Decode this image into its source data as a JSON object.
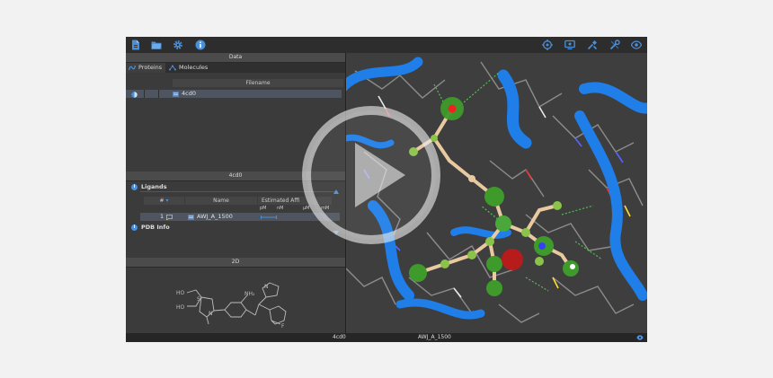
{
  "panels": {
    "data_title": "Data",
    "ligands_panel_title": "4cd0",
    "twod_title": "2D"
  },
  "tabs": [
    {
      "label": "Proteins"
    },
    {
      "label": "Molecules"
    }
  ],
  "proteins_table": {
    "column": "Filename",
    "rows": [
      {
        "filename": "4cd0"
      }
    ]
  },
  "ligands": {
    "section_label": "Ligands",
    "columns": {
      "num": "#",
      "name": "Name",
      "affinity": "Estimated Affi"
    },
    "affinity_units": [
      "pM",
      "nM",
      "µM",
      "mM"
    ],
    "rows": [
      {
        "num": "1",
        "name": "AWJ_A_1500"
      }
    ]
  },
  "pdb_info_label": "PDB Info",
  "molecule_labels": {
    "amine": "NH₂",
    "nitrogen": "N",
    "hydroxyl_1": "HO",
    "hydroxyl_2": "HO",
    "sulfur": "S",
    "fluorine": "F"
  },
  "status_bar": {
    "protein": "4cd0",
    "ligand": "AWJ_A_1500"
  },
  "icons": {
    "left_toolbar": [
      "file-icon",
      "folder-open-icon",
      "gear-icon",
      "info-icon"
    ],
    "right_toolbar": [
      "target-icon",
      "screen-icon",
      "tools-icon",
      "wrench-icon",
      "eye-icon"
    ]
  },
  "colors": {
    "accent": "#4a90d9",
    "ribbon": "#1f7ee8",
    "ligand_atom": "#3e9a2a",
    "background": "#3e3e3e"
  }
}
